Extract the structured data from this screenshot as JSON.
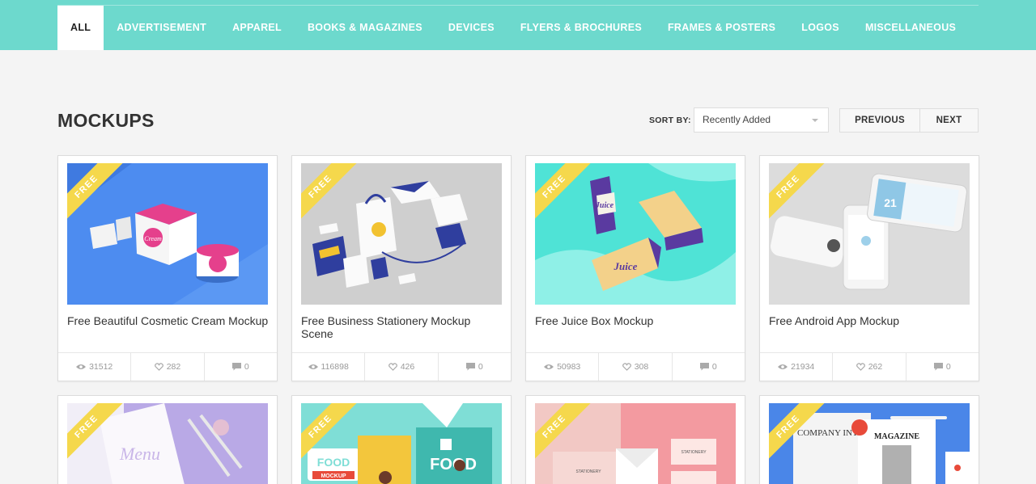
{
  "nav": {
    "items": [
      {
        "label": "ALL",
        "active": true
      },
      {
        "label": "ADVERTISEMENT"
      },
      {
        "label": "APPAREL"
      },
      {
        "label": "BOOKS & MAGAZINES"
      },
      {
        "label": "DEVICES"
      },
      {
        "label": "FLYERS & BROCHURES"
      },
      {
        "label": "FRAMES & POSTERS"
      },
      {
        "label": "LOGOS"
      },
      {
        "label": "MISCELLANEOUS"
      }
    ]
  },
  "page": {
    "title": "MOCKUPS"
  },
  "sort": {
    "label": "SORT BY:",
    "selected": "Recently Added"
  },
  "pager": {
    "previous": "PREVIOUS",
    "next": "NEXT"
  },
  "badge": "FREE",
  "colors": {
    "accent": "#6dd9cd",
    "ribbon": "#f5d84c"
  },
  "cards": [
    {
      "title": "Free Beautiful Cosmetic Cream Mockup",
      "views": "31512",
      "likes": "282",
      "comments": "0"
    },
    {
      "title": "Free Business Stationery Mockup Scene",
      "views": "116898",
      "likes": "426",
      "comments": "0"
    },
    {
      "title": "Free Juice Box Mockup",
      "views": "50983",
      "likes": "308",
      "comments": "0"
    },
    {
      "title": "Free Android App Mockup",
      "views": "21934",
      "likes": "262",
      "comments": "0"
    }
  ],
  "thumb_texts": {
    "cream": "Cream",
    "juice_1": "Juice",
    "juice_2": "Juice",
    "android": "21",
    "menu": "Menu",
    "food_1": "FOOD",
    "food_mockup": "MOCKUP",
    "food_2": "FOOD",
    "stationery_1": "STATIONERY",
    "stationery_2": "STATIONERY",
    "magazine_1": "COMPANY INTRO",
    "magazine_2": "MAGAZINE"
  }
}
